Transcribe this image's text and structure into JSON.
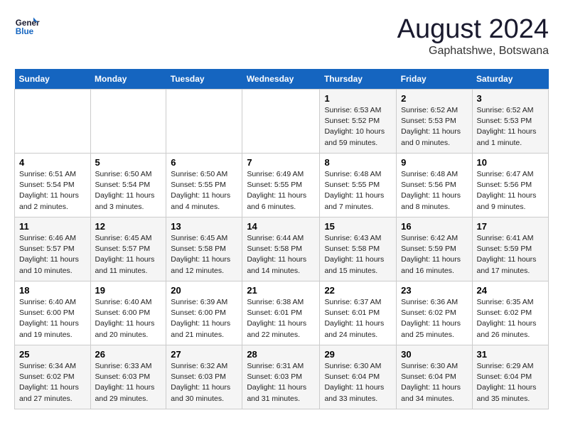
{
  "header": {
    "logo_line1": "General",
    "logo_line2": "Blue",
    "month": "August 2024",
    "location": "Gaphatshwe, Botswana"
  },
  "days_of_week": [
    "Sunday",
    "Monday",
    "Tuesday",
    "Wednesday",
    "Thursday",
    "Friday",
    "Saturday"
  ],
  "weeks": [
    [
      {
        "day": "",
        "info": ""
      },
      {
        "day": "",
        "info": ""
      },
      {
        "day": "",
        "info": ""
      },
      {
        "day": "",
        "info": ""
      },
      {
        "day": "1",
        "info": "Sunrise: 6:53 AM\nSunset: 5:52 PM\nDaylight: 10 hours and 59 minutes."
      },
      {
        "day": "2",
        "info": "Sunrise: 6:52 AM\nSunset: 5:53 PM\nDaylight: 11 hours and 0 minutes."
      },
      {
        "day": "3",
        "info": "Sunrise: 6:52 AM\nSunset: 5:53 PM\nDaylight: 11 hours and 1 minute."
      }
    ],
    [
      {
        "day": "4",
        "info": "Sunrise: 6:51 AM\nSunset: 5:54 PM\nDaylight: 11 hours and 2 minutes."
      },
      {
        "day": "5",
        "info": "Sunrise: 6:50 AM\nSunset: 5:54 PM\nDaylight: 11 hours and 3 minutes."
      },
      {
        "day": "6",
        "info": "Sunrise: 6:50 AM\nSunset: 5:55 PM\nDaylight: 11 hours and 4 minutes."
      },
      {
        "day": "7",
        "info": "Sunrise: 6:49 AM\nSunset: 5:55 PM\nDaylight: 11 hours and 6 minutes."
      },
      {
        "day": "8",
        "info": "Sunrise: 6:48 AM\nSunset: 5:55 PM\nDaylight: 11 hours and 7 minutes."
      },
      {
        "day": "9",
        "info": "Sunrise: 6:48 AM\nSunset: 5:56 PM\nDaylight: 11 hours and 8 minutes."
      },
      {
        "day": "10",
        "info": "Sunrise: 6:47 AM\nSunset: 5:56 PM\nDaylight: 11 hours and 9 minutes."
      }
    ],
    [
      {
        "day": "11",
        "info": "Sunrise: 6:46 AM\nSunset: 5:57 PM\nDaylight: 11 hours and 10 minutes."
      },
      {
        "day": "12",
        "info": "Sunrise: 6:45 AM\nSunset: 5:57 PM\nDaylight: 11 hours and 11 minutes."
      },
      {
        "day": "13",
        "info": "Sunrise: 6:45 AM\nSunset: 5:58 PM\nDaylight: 11 hours and 12 minutes."
      },
      {
        "day": "14",
        "info": "Sunrise: 6:44 AM\nSunset: 5:58 PM\nDaylight: 11 hours and 14 minutes."
      },
      {
        "day": "15",
        "info": "Sunrise: 6:43 AM\nSunset: 5:58 PM\nDaylight: 11 hours and 15 minutes."
      },
      {
        "day": "16",
        "info": "Sunrise: 6:42 AM\nSunset: 5:59 PM\nDaylight: 11 hours and 16 minutes."
      },
      {
        "day": "17",
        "info": "Sunrise: 6:41 AM\nSunset: 5:59 PM\nDaylight: 11 hours and 17 minutes."
      }
    ],
    [
      {
        "day": "18",
        "info": "Sunrise: 6:40 AM\nSunset: 6:00 PM\nDaylight: 11 hours and 19 minutes."
      },
      {
        "day": "19",
        "info": "Sunrise: 6:40 AM\nSunset: 6:00 PM\nDaylight: 11 hours and 20 minutes."
      },
      {
        "day": "20",
        "info": "Sunrise: 6:39 AM\nSunset: 6:00 PM\nDaylight: 11 hours and 21 minutes."
      },
      {
        "day": "21",
        "info": "Sunrise: 6:38 AM\nSunset: 6:01 PM\nDaylight: 11 hours and 22 minutes."
      },
      {
        "day": "22",
        "info": "Sunrise: 6:37 AM\nSunset: 6:01 PM\nDaylight: 11 hours and 24 minutes."
      },
      {
        "day": "23",
        "info": "Sunrise: 6:36 AM\nSunset: 6:02 PM\nDaylight: 11 hours and 25 minutes."
      },
      {
        "day": "24",
        "info": "Sunrise: 6:35 AM\nSunset: 6:02 PM\nDaylight: 11 hours and 26 minutes."
      }
    ],
    [
      {
        "day": "25",
        "info": "Sunrise: 6:34 AM\nSunset: 6:02 PM\nDaylight: 11 hours and 27 minutes."
      },
      {
        "day": "26",
        "info": "Sunrise: 6:33 AM\nSunset: 6:03 PM\nDaylight: 11 hours and 29 minutes."
      },
      {
        "day": "27",
        "info": "Sunrise: 6:32 AM\nSunset: 6:03 PM\nDaylight: 11 hours and 30 minutes."
      },
      {
        "day": "28",
        "info": "Sunrise: 6:31 AM\nSunset: 6:03 PM\nDaylight: 11 hours and 31 minutes."
      },
      {
        "day": "29",
        "info": "Sunrise: 6:30 AM\nSunset: 6:04 PM\nDaylight: 11 hours and 33 minutes."
      },
      {
        "day": "30",
        "info": "Sunrise: 6:30 AM\nSunset: 6:04 PM\nDaylight: 11 hours and 34 minutes."
      },
      {
        "day": "31",
        "info": "Sunrise: 6:29 AM\nSunset: 6:04 PM\nDaylight: 11 hours and 35 minutes."
      }
    ]
  ]
}
